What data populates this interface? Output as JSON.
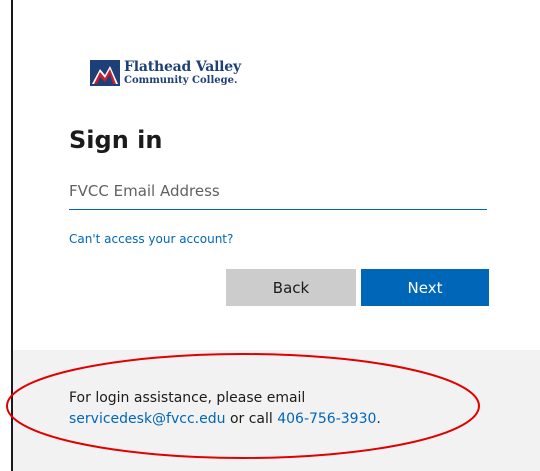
{
  "logo": {
    "line1": "Flathead Valley",
    "line2": "Community College."
  },
  "signin": {
    "title": "Sign in",
    "email_placeholder": "FVCC Email Address",
    "email_value": "",
    "cant_access_link": "Can't access your account?",
    "back_label": "Back",
    "next_label": "Next"
  },
  "footer": {
    "text_before": "For login assistance, please email",
    "email_link": "servicedesk@fvcc.edu",
    "text_middle": "or call",
    "phone_link": "406-756-3930",
    "text_end": "."
  },
  "colors": {
    "accent": "#0067b8",
    "back_button": "#cccccc",
    "footer_bg": "#f2f2f2",
    "annotation": "#e00000",
    "logo_navy": "#1f3f79",
    "logo_red": "#c8202f"
  }
}
